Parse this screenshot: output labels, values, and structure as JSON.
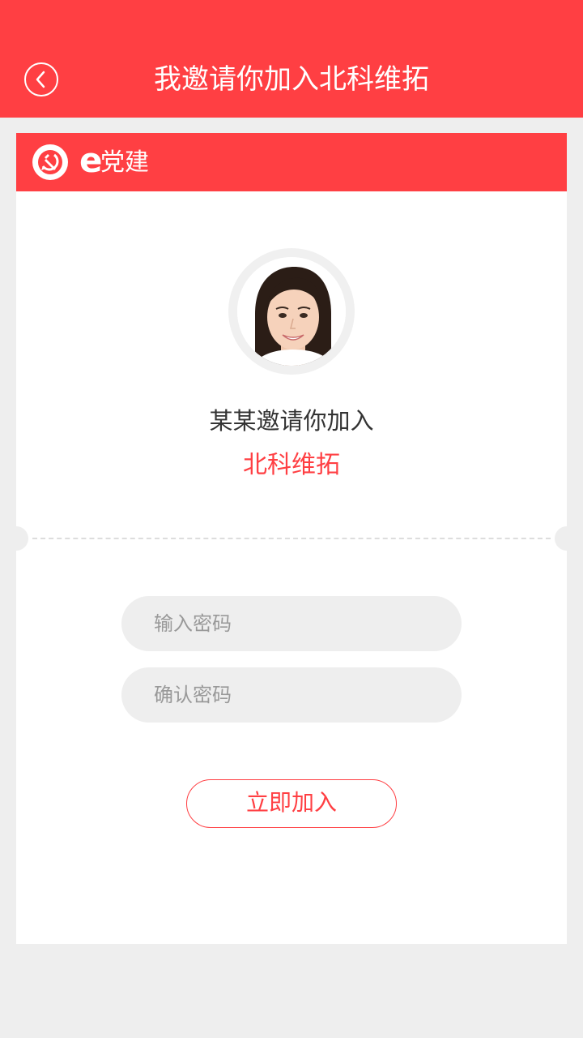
{
  "header": {
    "title": "我邀请你加入北科维拓",
    "back_icon": "chevron-left-icon"
  },
  "brand": {
    "e": "e",
    "name": "党建",
    "logo_icon": "party-emblem-icon"
  },
  "invitation": {
    "text": "某某邀请你加入",
    "org_name": "北科维拓"
  },
  "form": {
    "password_placeholder": "输入密码",
    "confirm_placeholder": "确认密码",
    "join_label": "立即加入"
  },
  "colors": {
    "primary": "#ff3f43",
    "background": "#eeeeee",
    "input_bg": "#eeeeee",
    "text": "#333333",
    "placeholder": "#999999"
  }
}
